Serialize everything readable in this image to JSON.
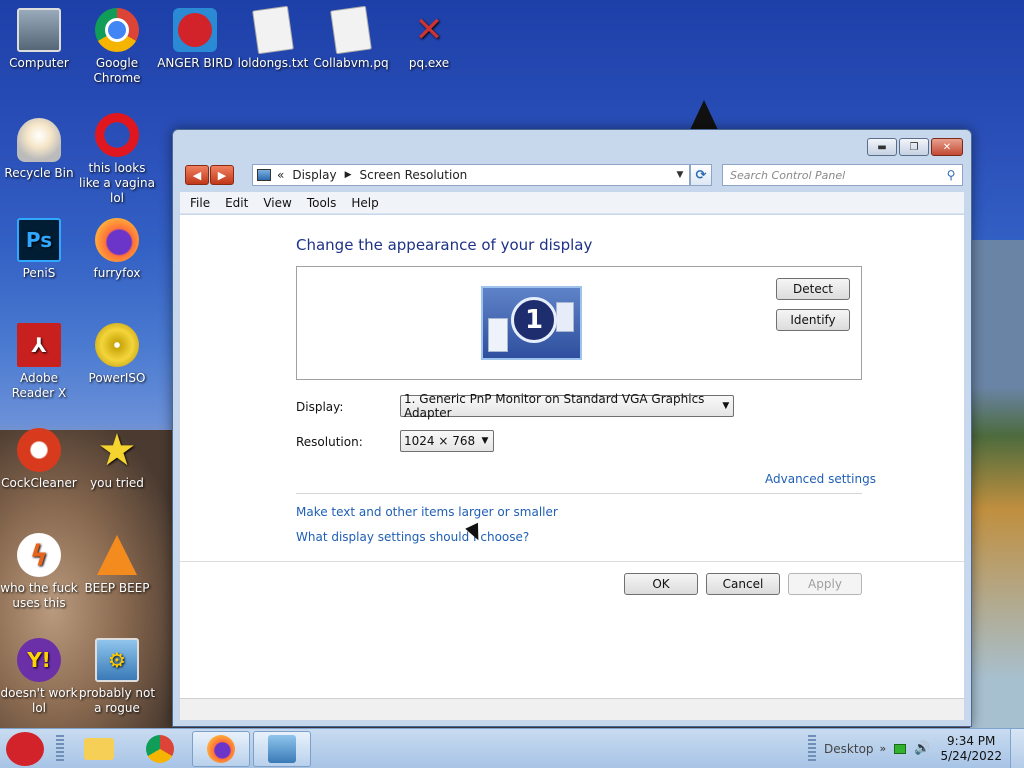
{
  "desktop": {
    "icons": [
      {
        "label": "Computer"
      },
      {
        "label": "Google Chrome"
      },
      {
        "label": "ANGER BIRD"
      },
      {
        "label": "loldongs.txt"
      },
      {
        "label": "Collabvm.pq"
      },
      {
        "label": "pq.exe"
      },
      {
        "label": "Recycle Bin"
      },
      {
        "label": "this looks like a vagina lol"
      },
      {
        "label": "PeniS"
      },
      {
        "label": "furryfox"
      },
      {
        "label": "Adobe Reader X"
      },
      {
        "label": "PowerISO"
      },
      {
        "label": "CockCleaner"
      },
      {
        "label": "you tried"
      },
      {
        "label": "who the fuck uses this"
      },
      {
        "label": "BEEP BEEP"
      },
      {
        "label": "doesn't work lol"
      },
      {
        "label": "probably not a rogue"
      }
    ]
  },
  "window": {
    "breadcrumb": [
      "Display",
      "Screen Resolution"
    ],
    "breadcrumb_prefix": "«",
    "search_placeholder": "Search Control Panel",
    "menu": [
      "File",
      "Edit",
      "View",
      "Tools",
      "Help"
    ],
    "heading": "Change the appearance of your display",
    "monitor_number": "1",
    "detect_label": "Detect",
    "identify_label": "Identify",
    "display_label": "Display:",
    "display_value": "1. Generic PnP Monitor on Standard VGA Graphics Adapter",
    "resolution_label": "Resolution:",
    "resolution_value": "1024 × 768",
    "advanced_link": "Advanced settings",
    "text_size_link": "Make text and other items larger or smaller",
    "help_link": "What display settings should I choose?",
    "ok_label": "OK",
    "cancel_label": "Cancel",
    "apply_label": "Apply"
  },
  "taskbar": {
    "tray_desktop_label": "Desktop",
    "time": "9:34 PM",
    "date": "5/24/2022"
  }
}
